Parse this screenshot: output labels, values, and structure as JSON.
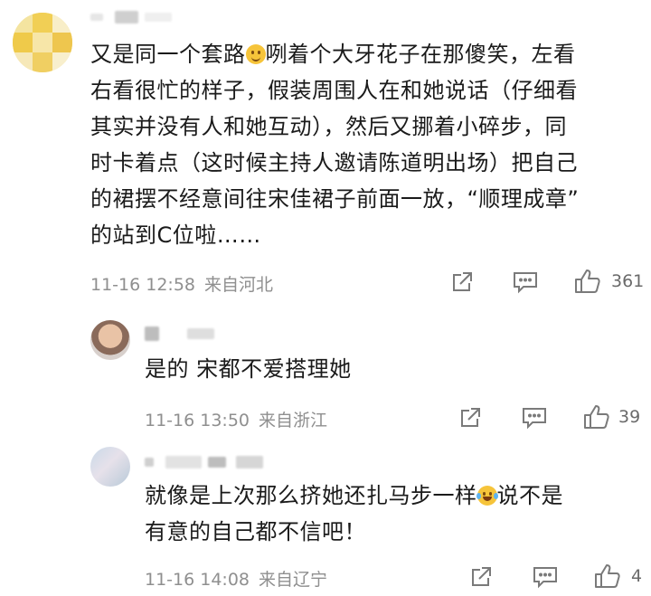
{
  "comments": [
    {
      "username": "",
      "text_lines": [
        "又是同一个套路",
        "咧着个大牙花子在那傻笑，左看",
        "右看很忙的样子，假装周围人在和她说话（仔细看",
        "其实并没有人和她互动），然后又挪着小碎步，同",
        "时卡着点（这时候主持人邀请陈道明出场）把自己",
        "的裙摆不经意间往宋佳裙子前面一放，“顺理成章”",
        "的站到C位啦……"
      ],
      "time": "11-16 12:58",
      "location": "来自河北",
      "like_count": "361"
    },
    {
      "username": "",
      "text_lines": [
        "是的 宋都不爱搭理她"
      ],
      "time": "11-16 13:50",
      "location": "来自浙江",
      "like_count": "39"
    },
    {
      "username": "",
      "text_lines": [
        "就像是上次那么挤她还扎马步一样",
        "说不是",
        "有意的自己都不信吧！"
      ],
      "time": "11-16 14:08",
      "location": "来自辽宁",
      "like_count": "4"
    }
  ],
  "icons": {
    "share": "share-icon",
    "comment": "comment-icon",
    "like": "thumbs-up-icon",
    "smile_emoji": "smile-emoji-icon",
    "laugh_cry_emoji": "laugh-cry-emoji-icon"
  }
}
